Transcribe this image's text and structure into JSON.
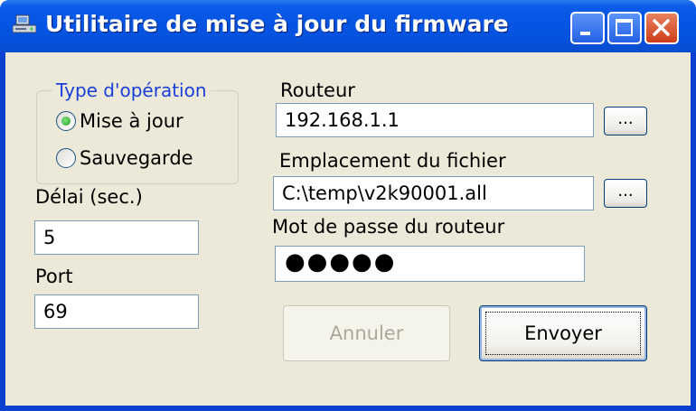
{
  "window": {
    "title": "Utilitaire de mise à jour du firmware"
  },
  "operation_group": {
    "legend": "Type d'opération",
    "options": [
      {
        "label": "Mise à jour",
        "selected": true
      },
      {
        "label": "Sauvegarde",
        "selected": false
      }
    ]
  },
  "delay": {
    "label": "Délai (sec.)",
    "value": "5"
  },
  "port": {
    "label": "Port",
    "value": "69"
  },
  "router": {
    "label": "Routeur",
    "value": "192.168.1.1",
    "browse_label": "..."
  },
  "file_location": {
    "label": "Emplacement du fichier",
    "value": "C:\\temp\\v2k90001.all",
    "browse_label": "..."
  },
  "router_password": {
    "label": "Mot de passe du routeur",
    "masked_value": "●●●●●"
  },
  "buttons": {
    "cancel_label": "Annuler",
    "send_label": "Envoyer"
  },
  "colors": {
    "titlebar": "#0654e2",
    "client_bg": "#ece9d8",
    "group_legend": "#1a3fd8",
    "close_button": "#cd3d1a"
  },
  "icons": {
    "app": "computer-disk-icon",
    "minimize": "minimize-icon",
    "maximize": "maximize-icon",
    "close": "close-icon"
  }
}
